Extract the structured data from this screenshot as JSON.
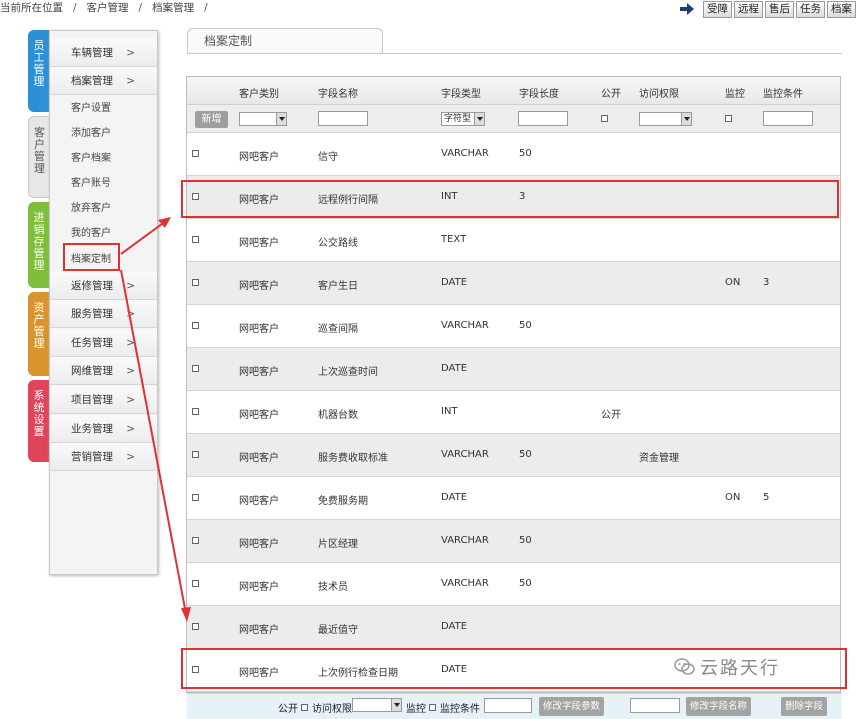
{
  "breadcrumb": {
    "items": [
      "当前所在位置",
      "客户管理",
      "档案管理"
    ],
    "sep": "/"
  },
  "top_buttons": [
    "受障",
    "远程",
    "售后",
    "任务",
    "档案"
  ],
  "vertical_tabs": [
    {
      "label": "员工管理",
      "color": "#2d8fd6"
    },
    {
      "label": "客户管理",
      "color": "#e7e7e7"
    },
    {
      "label": "进销存管理",
      "color": "#7dbf3a"
    },
    {
      "label": "资产管理",
      "color": "#d8952d"
    },
    {
      "label": "系统设置",
      "color": "#e0445a"
    }
  ],
  "menu": {
    "top_items": [
      {
        "label": "车辆管理",
        "chev": ">"
      },
      {
        "label": "档案管理",
        "chev": ">"
      }
    ],
    "sub_items": [
      "客户设置",
      "添加客户",
      "客户档案",
      "客户账号",
      "放弃客户",
      "我的客户",
      "档案定制"
    ],
    "bottom_items": [
      {
        "label": "返修管理",
        "chev": ">"
      },
      {
        "label": "服务管理",
        "chev": ">"
      },
      {
        "label": "任务管理",
        "chev": ">"
      },
      {
        "label": "网维管理",
        "chev": ">"
      },
      {
        "label": "项目管理",
        "chev": ">"
      },
      {
        "label": "业务管理",
        "chev": ">"
      },
      {
        "label": "营销管理",
        "chev": ">"
      }
    ]
  },
  "panel": {
    "tab_title": "档案定制"
  },
  "table": {
    "headers": [
      "客户类别",
      "字段名称",
      "字段类型",
      "字段长度",
      "公开",
      "访问权限",
      "监控",
      "监控条件"
    ],
    "add_button": "新增",
    "type_select_value": "字符型",
    "rows": [
      {
        "category": "网吧客户",
        "name": "信守",
        "type": "VARCHAR",
        "length": "50",
        "public": "",
        "access": "",
        "monitor": "",
        "condition": ""
      },
      {
        "category": "网吧客户",
        "name": "远程例行间隔",
        "type": "INT",
        "length": "3",
        "public": "",
        "access": "",
        "monitor": "",
        "condition": ""
      },
      {
        "category": "网吧客户",
        "name": "公交路线",
        "type": "TEXT",
        "length": "",
        "public": "",
        "access": "",
        "monitor": "",
        "condition": ""
      },
      {
        "category": "网吧客户",
        "name": "客户生日",
        "type": "DATE",
        "length": "",
        "public": "",
        "access": "",
        "monitor": "ON",
        "condition": "3"
      },
      {
        "category": "网吧客户",
        "name": "巡查间隔",
        "type": "VARCHAR",
        "length": "50",
        "public": "",
        "access": "",
        "monitor": "",
        "condition": ""
      },
      {
        "category": "网吧客户",
        "name": "上次巡查时间",
        "type": "DATE",
        "length": "",
        "public": "",
        "access": "",
        "monitor": "",
        "condition": ""
      },
      {
        "category": "网吧客户",
        "name": "机器台数",
        "type": "INT",
        "length": "",
        "public": "公开",
        "access": "",
        "monitor": "",
        "condition": ""
      },
      {
        "category": "网吧客户",
        "name": "服务费收取标准",
        "type": "VARCHAR",
        "length": "50",
        "public": "",
        "access": "资金管理",
        "monitor": "",
        "condition": ""
      },
      {
        "category": "网吧客户",
        "name": "免费服务期",
        "type": "DATE",
        "length": "",
        "public": "",
        "access": "",
        "monitor": "ON",
        "condition": "5"
      },
      {
        "category": "网吧客户",
        "name": "片区经理",
        "type": "VARCHAR",
        "length": "50",
        "public": "",
        "access": "",
        "monitor": "",
        "condition": ""
      },
      {
        "category": "网吧客户",
        "name": "技术员",
        "type": "VARCHAR",
        "length": "50",
        "public": "",
        "access": "",
        "monitor": "",
        "condition": ""
      },
      {
        "category": "网吧客户",
        "name": "最近值守",
        "type": "DATE",
        "length": "",
        "public": "",
        "access": "",
        "monitor": "",
        "condition": ""
      },
      {
        "category": "网吧客户",
        "name": "上次例行检查日期",
        "type": "DATE",
        "length": "",
        "public": "",
        "access": "",
        "monitor": "",
        "condition": ""
      }
    ]
  },
  "footer": {
    "public_label": "公开",
    "access_label": "访问权限",
    "monitor_label": "监控",
    "condition_label": "监控条件",
    "btn_modify_params": "修改字段参数",
    "btn_modify_name": "修改字段名称",
    "btn_delete": "删除字段"
  },
  "watermark": {
    "text": "云路天行",
    "icon": "wechat-icon"
  },
  "colors": {
    "highlight": "#e03030",
    "odd_row": "#ffffff",
    "even_row": "#ececec"
  }
}
